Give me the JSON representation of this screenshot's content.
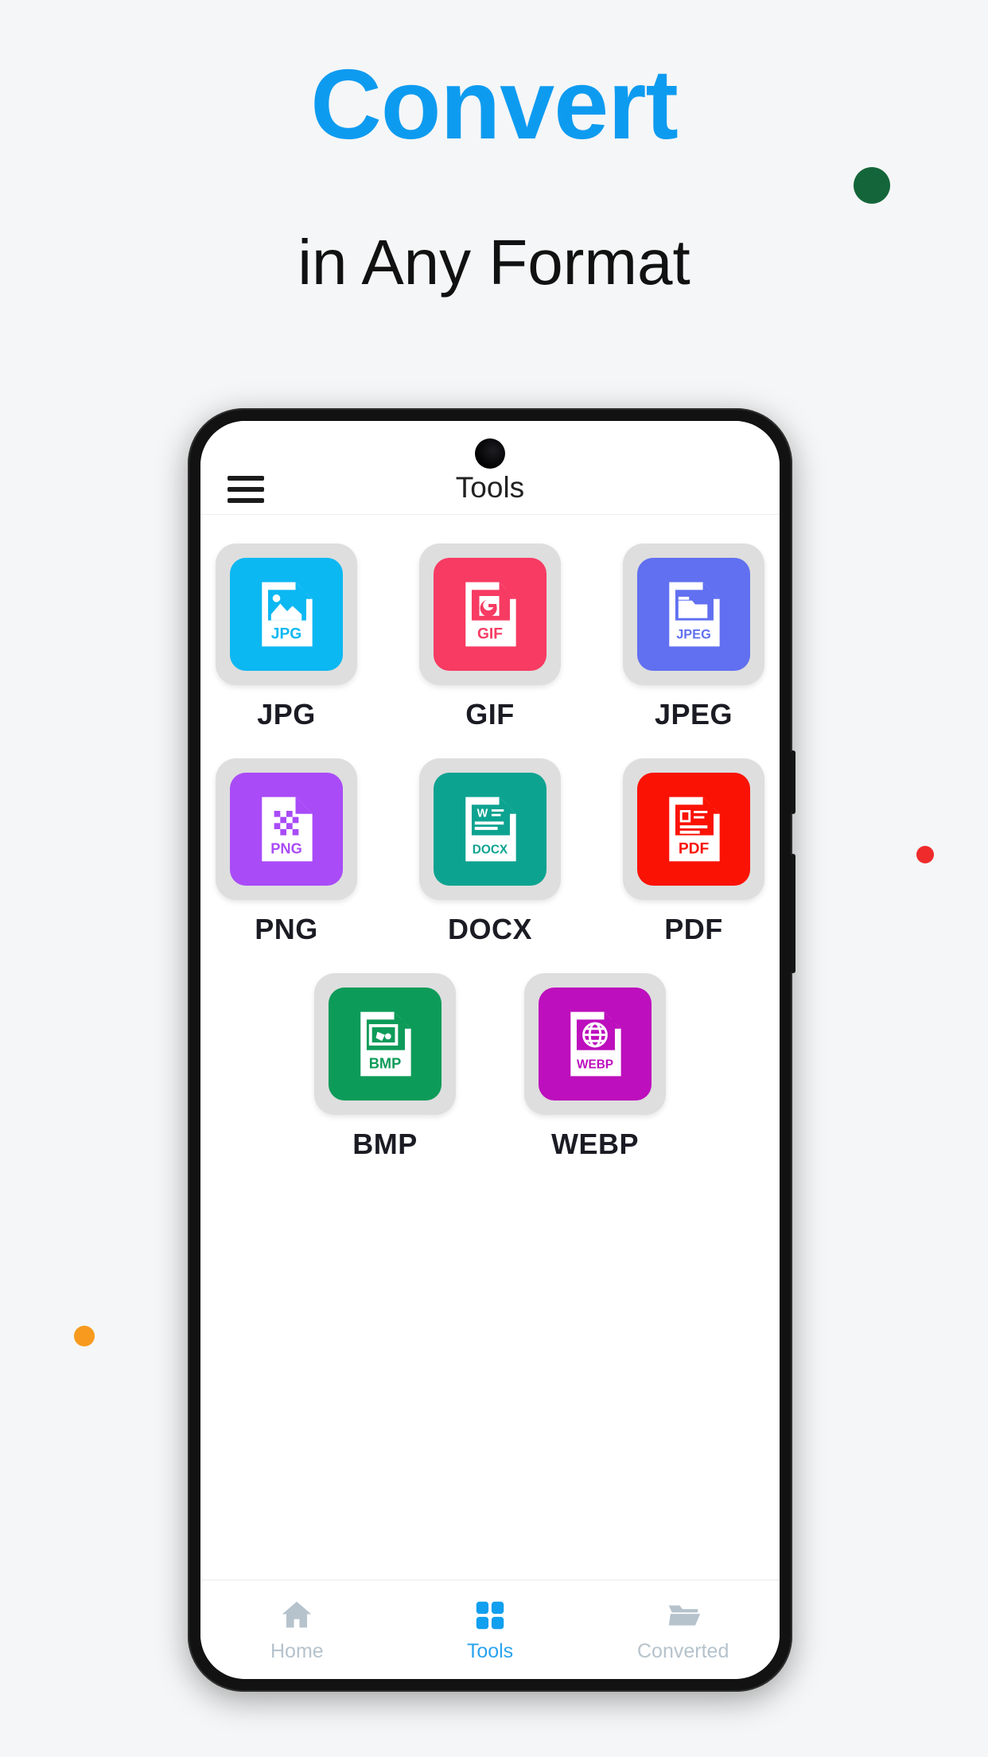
{
  "promo": {
    "headline": "Convert",
    "subheadline": "in Any Format",
    "headline_color": "#0d9bf0",
    "background_color": "#f5f6f7",
    "decor_dots": [
      {
        "name": "dot-green",
        "color": "#14663a"
      },
      {
        "name": "dot-red",
        "color": "#ef2b2b"
      },
      {
        "name": "dot-orange",
        "color": "#f79a1e"
      }
    ]
  },
  "app": {
    "appbar": {
      "menu_icon": "hamburger-menu-icon",
      "title": "Tools"
    },
    "formats": [
      {
        "label": "JPG",
        "color": "#0cb8f2",
        "glyph": "image-file-icon",
        "badge": "JPG"
      },
      {
        "label": "GIF",
        "color": "#f73b63",
        "glyph": "gif-file-icon",
        "badge": "GIF"
      },
      {
        "label": "JPEG",
        "color": "#6170f0",
        "glyph": "photo-file-icon",
        "badge": "JPEG"
      },
      {
        "label": "PNG",
        "color": "#a94bf7",
        "glyph": "pixels-file-icon",
        "badge": "PNG"
      },
      {
        "label": "DOCX",
        "color": "#0da391",
        "glyph": "word-file-icon",
        "badge": "DOCX"
      },
      {
        "label": "PDF",
        "color": "#fa1205",
        "glyph": "pdf-file-icon",
        "badge": "PDF"
      },
      {
        "label": "BMP",
        "color": "#0d9b59",
        "glyph": "bitmap-file-icon",
        "badge": "BMP"
      },
      {
        "label": "WEBP",
        "color": "#bd0fbd",
        "glyph": "globe-file-icon",
        "badge": "WEBP"
      }
    ],
    "tile_background": "#dedede",
    "bottom_nav": {
      "active_color": "#2aa3ef",
      "inactive_color": "#b6c3cc",
      "items": [
        {
          "label": "Home",
          "icon": "home-icon",
          "active": false
        },
        {
          "label": "Tools",
          "icon": "grid-icon",
          "active": true
        },
        {
          "label": "Converted",
          "icon": "folder-icon",
          "active": false
        }
      ]
    }
  }
}
